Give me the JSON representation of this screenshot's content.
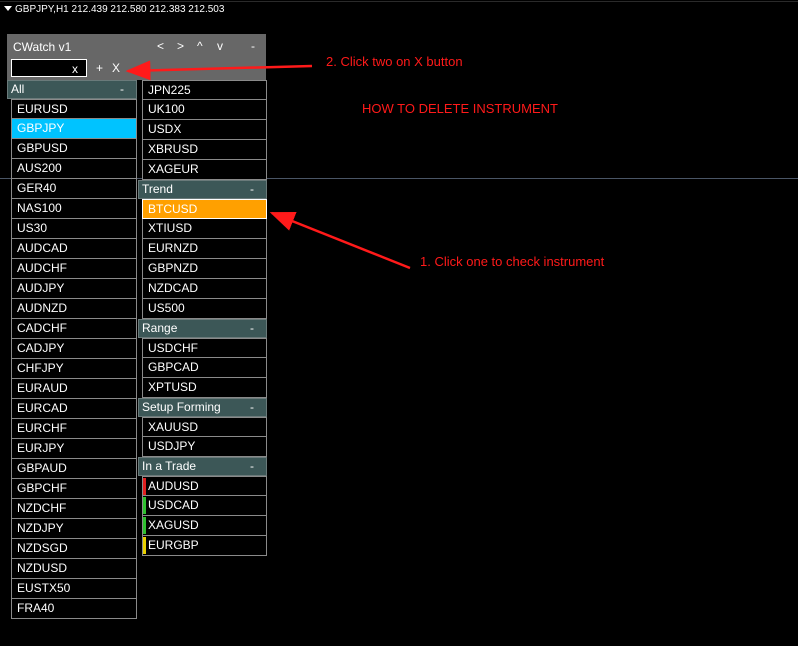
{
  "chart_header": {
    "text": "GBPJPY,H1  212.439 212.580 212.383 212.503"
  },
  "panel": {
    "title": "CWatch v1",
    "nav": [
      "<",
      ">",
      "^",
      "v",
      "-"
    ],
    "input_value": "",
    "input_clear": "x",
    "add_label": "+",
    "delete_label": "X"
  },
  "left_column": {
    "header": "All",
    "collapse": "-",
    "items": [
      "EURUSD",
      "GBPJPY",
      "GBPUSD",
      "AUS200",
      "GER40",
      "NAS100",
      "US30",
      "AUDCAD",
      "AUDCHF",
      "AUDJPY",
      "AUDNZD",
      "CADCHF",
      "CADJPY",
      "CHFJPY",
      "EURAUD",
      "EURCAD",
      "EURCHF",
      "EURJPY",
      "GBPAUD",
      "GBPCHF",
      "NZDCHF",
      "NZDJPY",
      "NZDSGD",
      "NZDUSD",
      "EUSTX50",
      "FRA40"
    ],
    "selected": "GBPJPY",
    "selected_color": "#00c3ff"
  },
  "right_column": {
    "top_items": [
      "JPN225",
      "UK100",
      "USDX",
      "XBRUSD",
      "XAGEUR"
    ],
    "groups": [
      {
        "name": "Trend",
        "collapse": "-",
        "items": [
          {
            "symbol": "BTCUSD",
            "highlight": "#ffa000"
          },
          {
            "symbol": "XTIUSD"
          },
          {
            "symbol": "EURNZD"
          },
          {
            "symbol": "GBPNZD"
          },
          {
            "symbol": "NZDCAD"
          },
          {
            "symbol": "US500"
          }
        ]
      },
      {
        "name": "Range",
        "collapse": "-",
        "items": [
          {
            "symbol": "USDCHF"
          },
          {
            "symbol": "GBPCAD"
          },
          {
            "symbol": "XPTUSD"
          }
        ]
      },
      {
        "name": "Setup Forming",
        "collapse": "-",
        "items": [
          {
            "symbol": "XAUUSD"
          },
          {
            "symbol": "USDJPY"
          }
        ]
      },
      {
        "name": "In a Trade",
        "collapse": "-",
        "items": [
          {
            "symbol": "AUDUSD",
            "status": "#e02020"
          },
          {
            "symbol": "USDCAD",
            "status": "#30c030"
          },
          {
            "symbol": "XAGUSD",
            "status": "#30c030"
          },
          {
            "symbol": "EURGBP",
            "status": "#e8d000"
          }
        ]
      }
    ]
  },
  "annotations": {
    "step2": "2. Click two on X button",
    "title": "HOW TO DELETE INSTRUMENT",
    "step1": "1. Click one to check instrument",
    "color": "#ff1a1a"
  }
}
